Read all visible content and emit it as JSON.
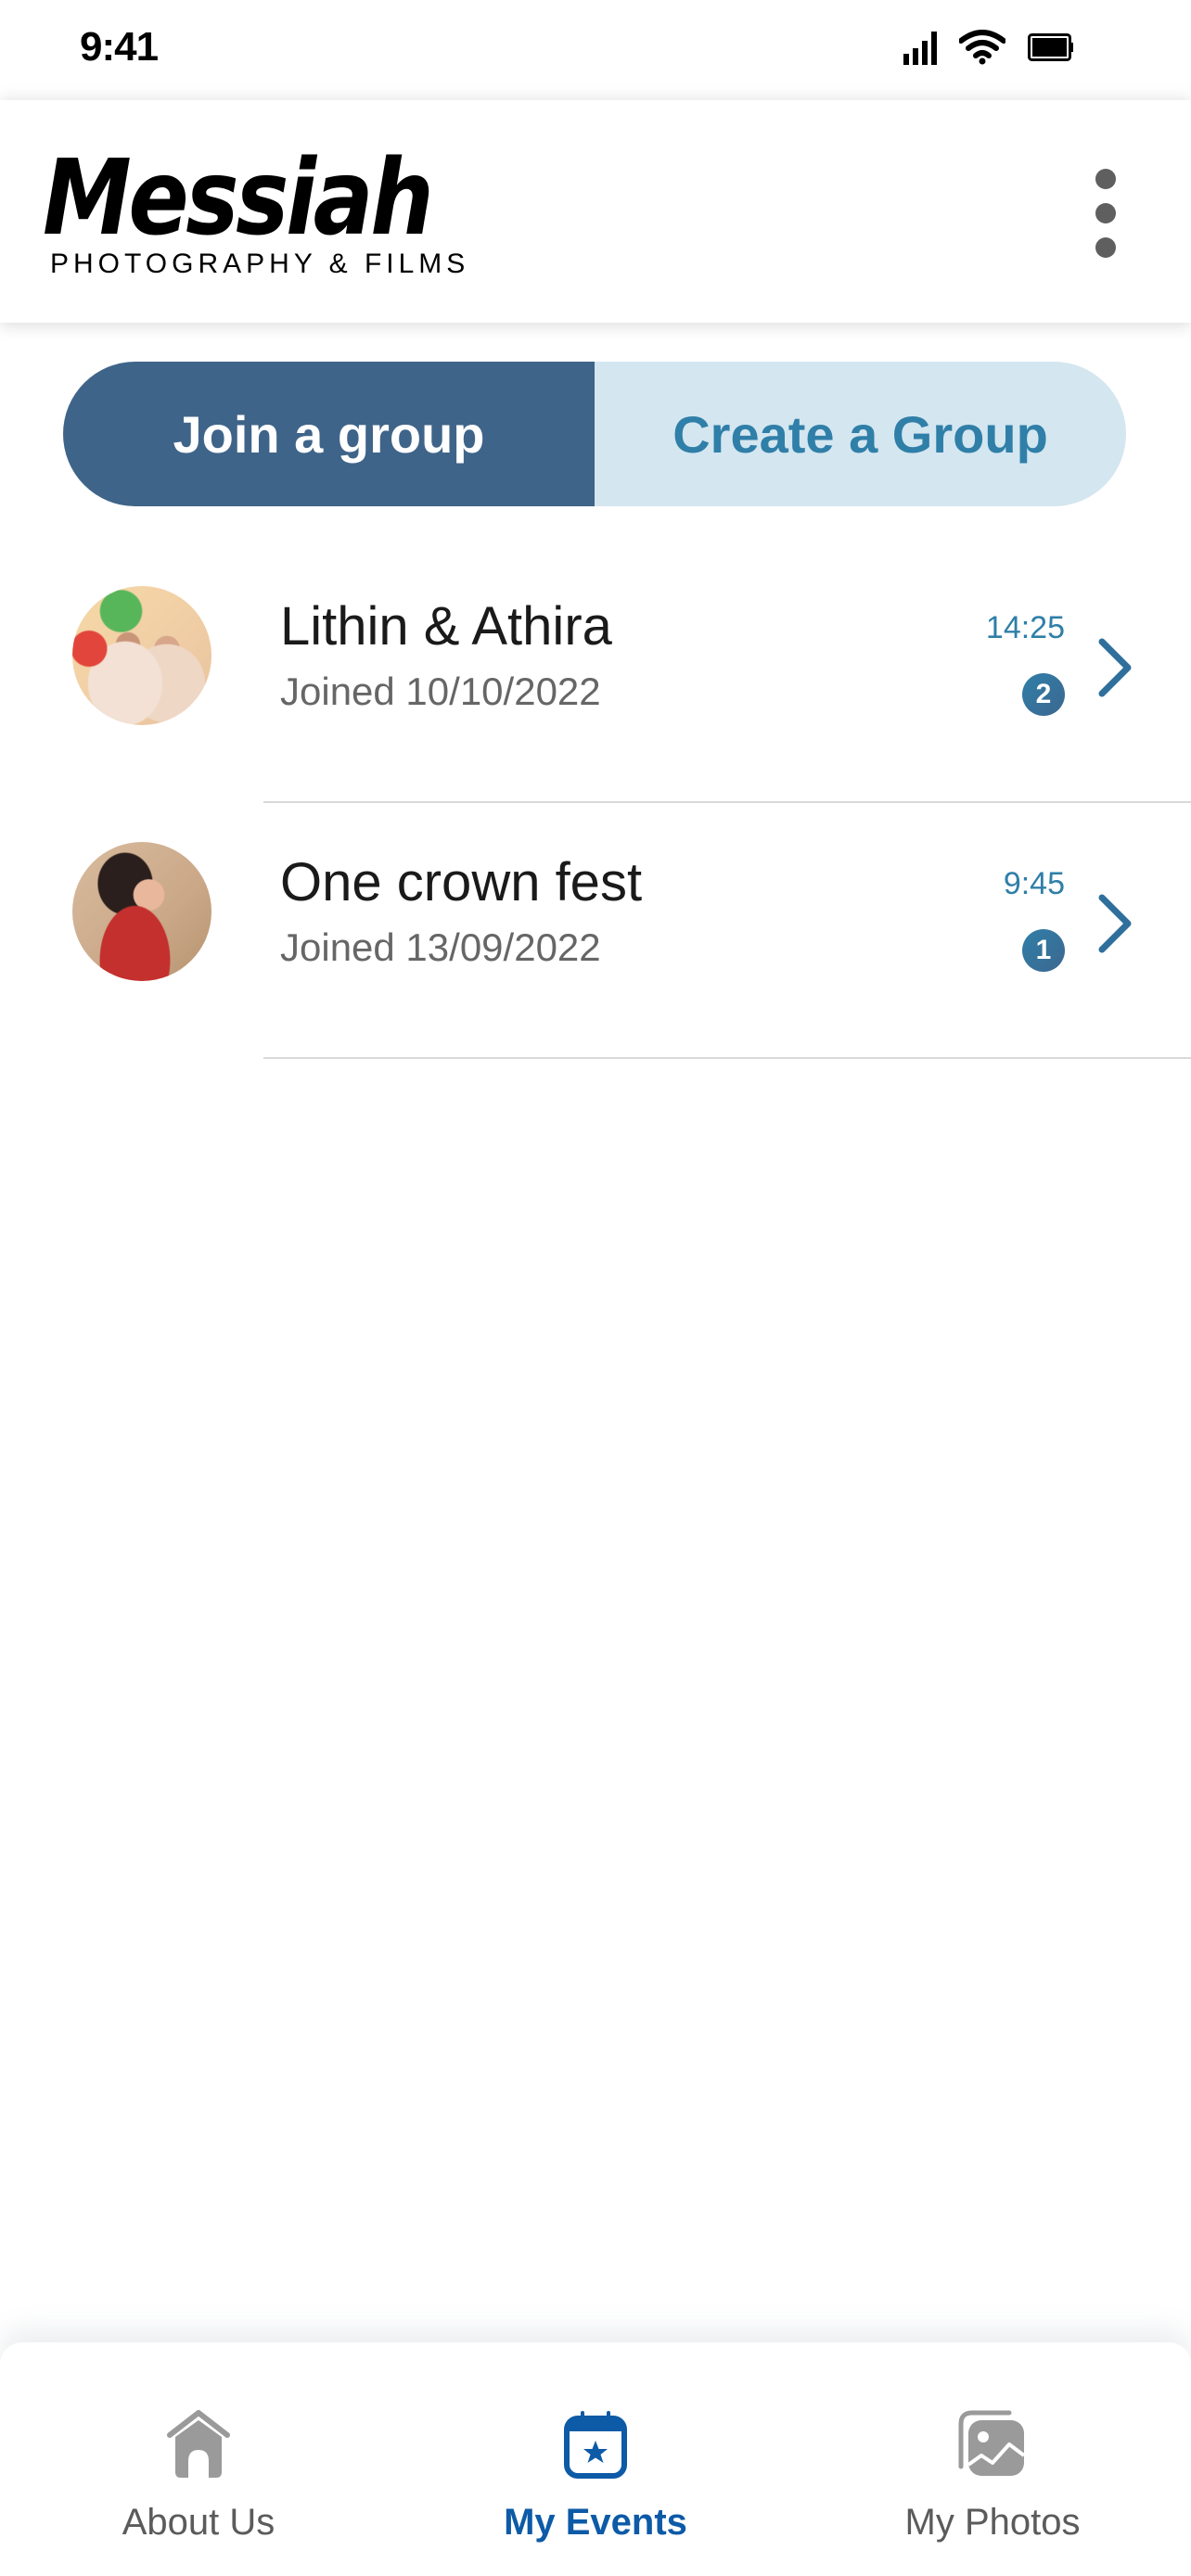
{
  "status_bar": {
    "time": "9:41",
    "icons": [
      "cellular-signal-icon",
      "wifi-icon",
      "battery-icon"
    ]
  },
  "header": {
    "logo_main": "Messiah",
    "logo_sub": "PHOTOGRAPHY & FILMS",
    "menu_icon": "more-vertical-icon"
  },
  "segmented_control": {
    "join_label": "Join a group",
    "create_label": "Create a Group",
    "selected": "join",
    "colors": {
      "selected_bg": "#3f6489",
      "unselected_bg": "#d4e6f0",
      "unselected_text": "#2f7fa8"
    }
  },
  "groups": [
    {
      "title": "Lithin & Athira",
      "subtitle": "Joined 10/10/2022",
      "time": "14:25",
      "unread": "2",
      "avatar": "couple-wedding-photo"
    },
    {
      "title": "One crown fest",
      "subtitle": "Joined 13/09/2022",
      "time": "9:45",
      "unread": "1",
      "avatar": "woman-red-dress-photo"
    }
  ],
  "bottom_nav": {
    "items": [
      {
        "label": "About Us",
        "icon": "home-icon",
        "active": false
      },
      {
        "label": "My Events",
        "icon": "calendar-star-icon",
        "active": true
      },
      {
        "label": "My Photos",
        "icon": "photo-gallery-icon",
        "active": false
      }
    ],
    "active_color": "#0d5aa7",
    "inactive_color": "#9a9a9a"
  }
}
